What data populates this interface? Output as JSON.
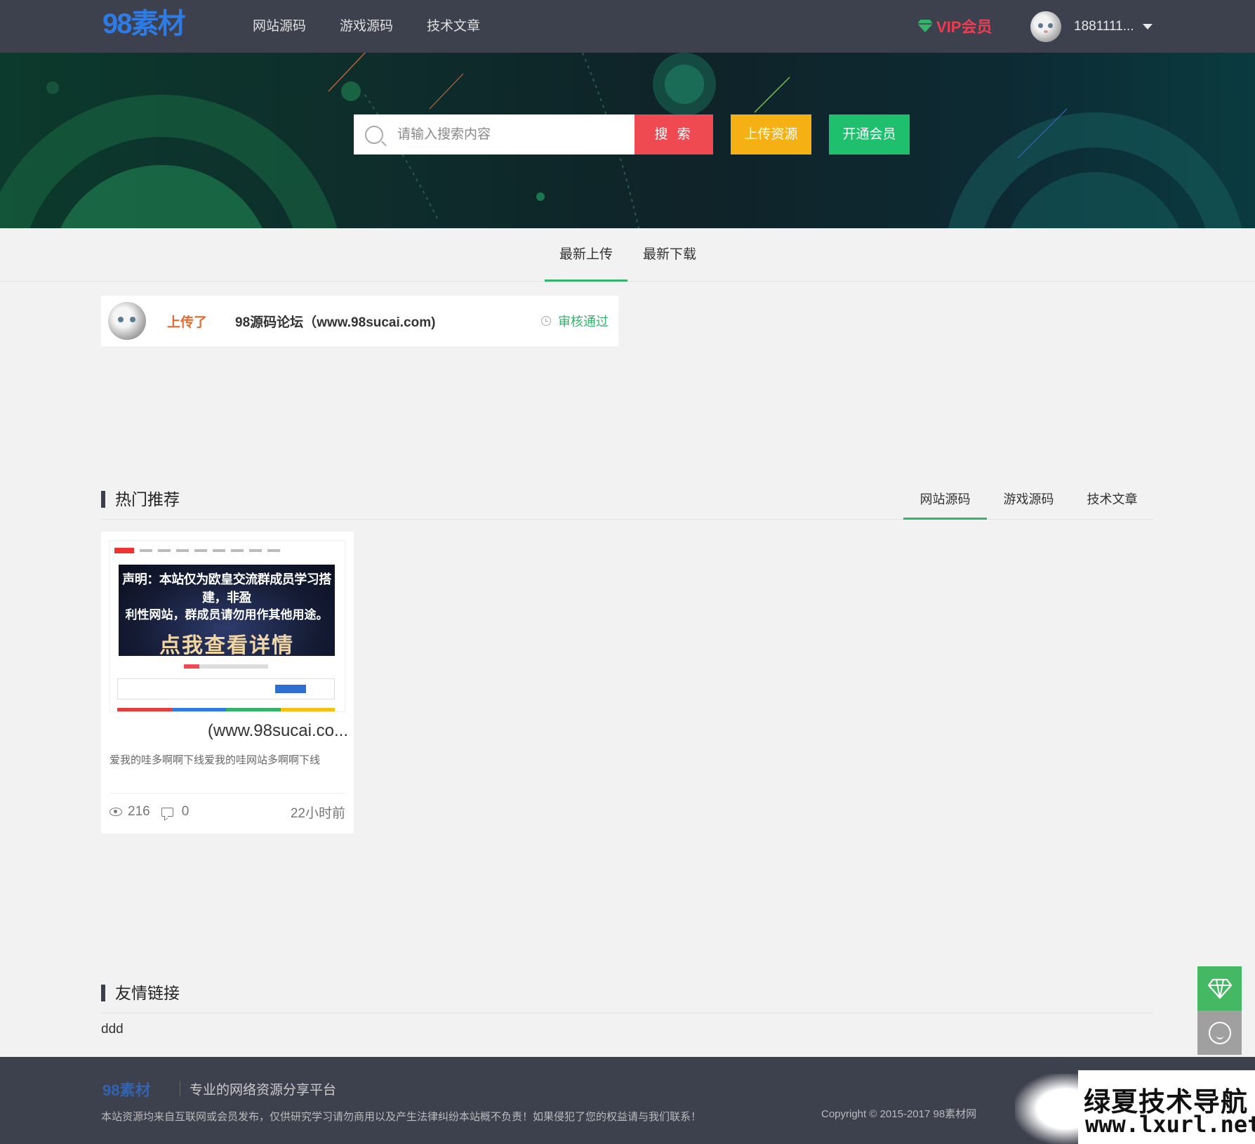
{
  "header": {
    "logo": "98素材",
    "nav": [
      "网站源码",
      "游戏源码",
      "技术文章"
    ],
    "vip_label": "VIP会员",
    "user_name": "1881111..."
  },
  "banner": {
    "search_placeholder": "请输入搜索内容",
    "search_button": "搜 索",
    "upload_button": "上传资源",
    "member_button": "开通会员"
  },
  "latest_tabs": [
    "最新上传",
    "最新下载"
  ],
  "latest_item": {
    "action": "上传了",
    "title": "98源码论坛（www.98sucai.com)",
    "status": "审核通过"
  },
  "hot": {
    "title": "热门推荐",
    "tabs": [
      "网站源码",
      "游戏源码",
      "技术文章"
    ],
    "card": {
      "thumb_line1": "声明：本站仅为欧皇交流群成员学习搭建，非盈",
      "thumb_line2": "利性网站，群成员请勿用作其他用途。",
      "thumb_cta": "点我查看详情",
      "title": "(www.98sucai.co...",
      "desc": "爱我的哇多啊啊下线爱我的哇网站多啊啊下线",
      "views": "216",
      "comments": "0",
      "time": "22小时前"
    }
  },
  "friends": {
    "title": "友情链接",
    "links": [
      "ddd"
    ]
  },
  "footer": {
    "logo": "98素材",
    "slogan": "专业的网络资源分享平台",
    "notice": "本站资源均来自互联网或会员发布，仅供研究学习请勿商用以及产生法律纠纷本站概不负责！如果侵犯了您的权益请与我们联系！",
    "copyright": "Copyright © 2015-2017 98素材网"
  },
  "watermark": {
    "line1": "绿夏技术导航",
    "line2": "www.lxurl.net"
  },
  "colors": {
    "header_bg": "#3d404d",
    "accent_green": "#35b36b",
    "search_red": "#ef4a51",
    "upload_yellow": "#f5b013",
    "member_green": "#1fc06d",
    "vip_red": "#ef3b52",
    "logo_blue": "#2f7be5"
  }
}
